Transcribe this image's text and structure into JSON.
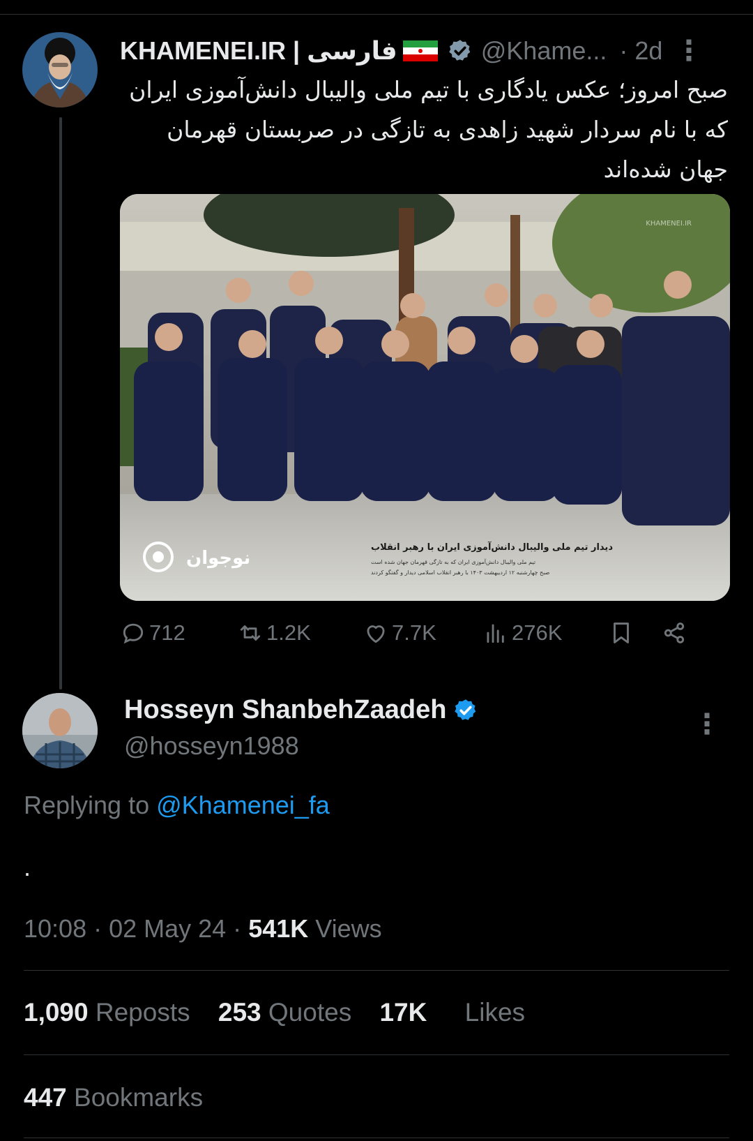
{
  "tweet": {
    "author_name": "KHAMENEI.IR | فارسی",
    "flag_icon": "iran-flag-icon",
    "verified_icon": "verified-gray-badge-icon",
    "handle": "@Khame...",
    "time_ago": "· 2d",
    "text": "صبح امروز؛ عکس یادگاری با تیم ملی والیبال دانش‌آموزی ایران که با نام سردار شهید زاهدی به تازگی در صربستان قهرمان جهان شده‌اند",
    "photo_caption": "دیدار تیم ملی والیبال دانش‌آموزی ایران با رهبر انقلاب",
    "photo_caption_line2": "تیم ملی والیبال دانش‌آموزی ایران که به تازگی قهرمان جهان شده است",
    "photo_caption_line3": "صبح چهارشنبه ۱۲ اردیبهشت ۱۴۰۳ با رهبر انقلاب اسلامی دیدار و گفتگو کردند",
    "photo_logo_text": "نوجوان",
    "photo_watermark": "KHAMENEI.IR",
    "actions": {
      "replies": "712",
      "reposts": "1.2K",
      "likes": "7.7K",
      "views": "276K"
    }
  },
  "reply": {
    "author_name": "Hosseyn ShanbehZaadeh",
    "verified_icon": "verified-blue-badge-icon",
    "handle": "@hosseyn1988",
    "replying_prefix": "Replying to",
    "replying_handle": "@Khamenei_fa",
    "body": ".",
    "time": "10:08 · 02 May 24 ·",
    "views_count": "541K",
    "views_label": "Views"
  },
  "stats": {
    "reposts_count": "1,090",
    "reposts_label": "Reposts",
    "quotes_count": "253",
    "quotes_label": "Quotes",
    "likes_count": "17K",
    "likes_label": "Likes",
    "bookmarks_count": "447",
    "bookmarks_label": "Bookmarks"
  },
  "colors": {
    "background": "#000000",
    "text": "#e7e9ea",
    "muted": "#71767b",
    "link": "#1d9bf0",
    "divider": "#2f3336"
  }
}
